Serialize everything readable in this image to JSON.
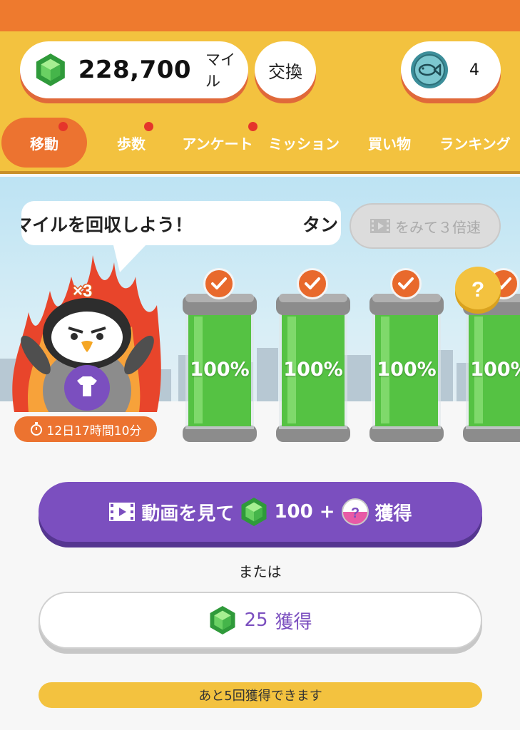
{
  "header": {
    "miles_value": "228,700",
    "miles_unit": "マイル",
    "exchange_label": "交換",
    "fish_count": "4"
  },
  "tabs": [
    {
      "label": "移動",
      "active": true,
      "badge": true
    },
    {
      "label": "歩数",
      "active": false,
      "badge": true
    },
    {
      "label": "アンケート",
      "active": false,
      "badge": true
    },
    {
      "label": "ミッション",
      "active": false,
      "badge": false
    },
    {
      "label": "買い物",
      "active": false,
      "badge": false
    },
    {
      "label": "ランキング",
      "active": false,
      "badge": false
    }
  ],
  "scene": {
    "bubble_text": "マイルを回収しよう！",
    "bubble_text_right": "タン",
    "speed_button_label": "をみて３倍速",
    "multiplier": "×3",
    "timer": "12日17時間10分",
    "tubes": [
      {
        "percent": "100%",
        "badge": "check"
      },
      {
        "percent": "100%",
        "badge": "check"
      },
      {
        "percent": "100%",
        "badge": "check"
      },
      {
        "percent": "100%",
        "badge": "question"
      }
    ]
  },
  "actions": {
    "video_button_prefix": "動画を見て",
    "video_button_amount": "100 +",
    "video_button_suffix": "獲得",
    "or_text": "または",
    "earn_button_amount": "25",
    "earn_button_suffix": "獲得",
    "remaining_text": "あと5回獲得できます"
  },
  "colors": {
    "top_orange": "#ee7a2e",
    "header_yellow": "#f3c23f",
    "accent_orange": "#ec7330",
    "purple": "#7b4fbf",
    "tube_green": "#55c243",
    "badge_red": "#e5352b"
  }
}
